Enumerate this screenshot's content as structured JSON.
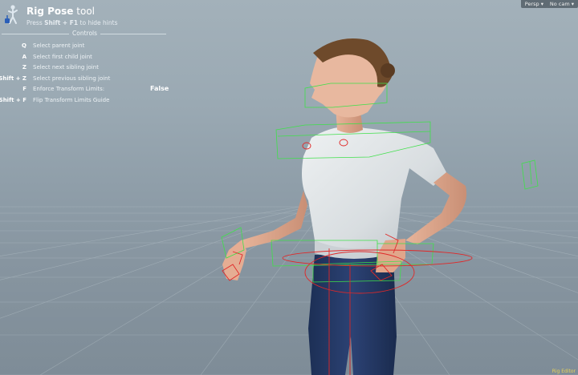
{
  "tool": {
    "name": "Rig Pose",
    "suffix": "tool",
    "hint_prefix": "Press",
    "hint_keys": "Shift + F1",
    "hint_suffix": "to hide hints",
    "section_label": "Controls"
  },
  "hints": [
    {
      "key": "Q",
      "desc": "Select parent joint",
      "value": ""
    },
    {
      "key": "A",
      "desc": "Select first child joint",
      "value": ""
    },
    {
      "key": "Z",
      "desc": "Select next sibling joint",
      "value": ""
    },
    {
      "key": "Shift + Z",
      "desc": "Select previous sibling joint",
      "value": ""
    },
    {
      "key": "F",
      "desc": "Enforce Transform Limits:",
      "value": "False"
    },
    {
      "key": "Shift + F",
      "desc": "Flip Transform Limits Guide",
      "value": ""
    }
  ],
  "viewport_menus": {
    "camera_mode": "Persp",
    "camera_select": "No cam"
  },
  "corner_label": "Rig Editor",
  "icons": {
    "tool_icon": "rig-pose-figure-icon",
    "dropdown_arrow": "chevron-down-icon"
  },
  "colors": {
    "guide_green": "#3fe04a",
    "handle_red": "#e02828",
    "hud_text": "#ffffff"
  }
}
